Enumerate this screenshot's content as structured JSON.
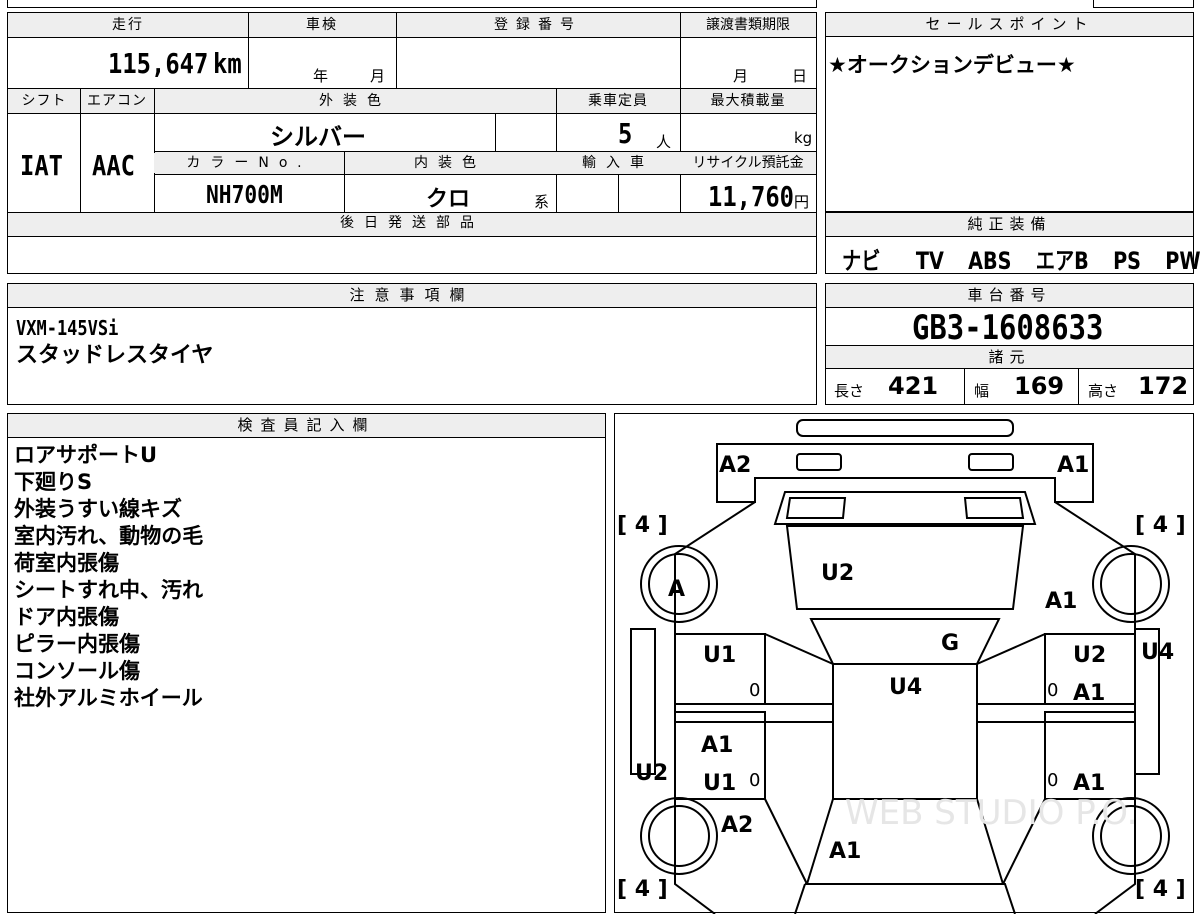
{
  "header": {
    "mileage_label": "走行",
    "mileage_value": "115,647",
    "mileage_unit": "km",
    "inspection_label": "車検",
    "inspection_year": "年",
    "inspection_month": "月",
    "registration_label": "登録番号",
    "transfer_label": "譲渡書類期限",
    "transfer_month": "月",
    "transfer_day": "日"
  },
  "spec": {
    "shift_label": "シフト",
    "shift_value": "IAT",
    "ac_label": "エアコン",
    "ac_value": "AAC",
    "exterior_color_label": "外装色",
    "exterior_color_value": "シルバー",
    "capacity_label": "乗車定員",
    "capacity_value": "5",
    "capacity_unit": "人",
    "max_load_label": "最大積載量",
    "max_load_unit": "kg",
    "color_no_label": "カラーNo.",
    "color_no_value": "NH700M",
    "interior_color_label": "内装色",
    "interior_color_value": "クロ",
    "interior_color_suffix": "系",
    "import_label": "輸入車",
    "recycle_label": "リサイクル預託金",
    "recycle_value": "11,760",
    "recycle_unit": "円",
    "later_parts_label": "後日発送部品"
  },
  "sales_point": {
    "label": "セールスポイント",
    "text": "★オークションデビュー★"
  },
  "equipment": {
    "label": "純正装備",
    "items": [
      "ナビ",
      "TV",
      "ABS",
      "エアB",
      "PS",
      "PW"
    ]
  },
  "notes": {
    "label": "注意事項欄",
    "lines": [
      "VXM-145VSi",
      "スタッドレスタイヤ"
    ]
  },
  "chassis": {
    "label": "車台番号",
    "value": "GB3-1608633",
    "specs_label": "諸元",
    "length_label": "長さ",
    "length_value": "421",
    "width_label": "幅",
    "width_value": "169",
    "height_label": "高さ",
    "height_value": "172"
  },
  "inspector": {
    "label": "検査員記入欄",
    "lines": [
      "ロアサポートU",
      "下廻りS",
      "外装うすい線キズ",
      "室内汚れ、動物の毛",
      "荷室内張傷",
      "シートすれ中、汚れ",
      "ドア内張傷",
      "ピラー内張傷",
      "コンソール傷",
      "社外アルミホイール"
    ]
  },
  "diagram": {
    "marks": [
      "A2",
      "A1",
      "U2",
      "A1",
      "A",
      "G",
      "U1",
      "U4",
      "U2",
      "A1",
      "U4",
      "A1",
      "U1",
      "U2",
      "A1",
      "A2",
      "A1"
    ],
    "tire_brackets": [
      "[ 4 ]",
      "[ 4 ]",
      "[ 4 ]",
      "[ 4 ]"
    ],
    "zeros": [
      "0",
      "0",
      "0",
      "0"
    ],
    "watermark": "WEB STUDIO P.O."
  }
}
